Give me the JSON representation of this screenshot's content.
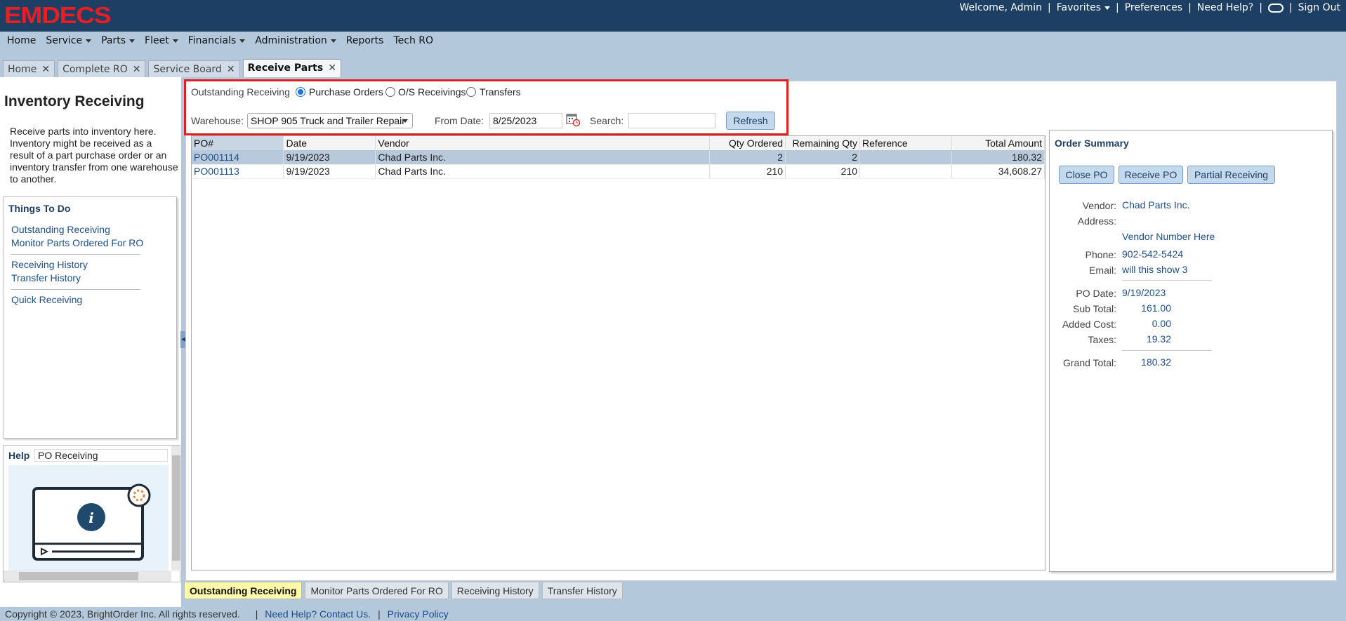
{
  "app": {
    "logo": "EMDECS"
  },
  "top": {
    "welcome": "Welcome, Admin",
    "favorites": "Favorites",
    "preferences": "Preferences",
    "help": "Need Help?",
    "signout": "Sign Out",
    "pipe": "|"
  },
  "menu": [
    {
      "label": "Home"
    },
    {
      "label": "Service"
    },
    {
      "label": "Parts"
    },
    {
      "label": "Fleet"
    },
    {
      "label": "Financials"
    },
    {
      "label": "Administration"
    },
    {
      "label": "Reports"
    },
    {
      "label": "Tech RO"
    }
  ],
  "tabs": [
    {
      "label": "Home"
    },
    {
      "label": "Complete RO"
    },
    {
      "label": "Service Board"
    },
    {
      "label": "Receive Parts"
    }
  ],
  "close_glyph": "✕",
  "left": {
    "title": "Inventory Receiving",
    "description": "Receive parts into inventory here. Inventory might be received as a result of a part purchase order or an inventory transfer from one warehouse to another.",
    "todo_title": "Things To Do",
    "links": [
      "Outstanding Receiving",
      "Monitor Parts Ordered For RO",
      "Receiving History",
      "Transfer History",
      "Quick Receiving"
    ],
    "help_label": "Help",
    "help_value": "PO Receiving",
    "help_icon": "i"
  },
  "filter": {
    "label": "Outstanding Receiving",
    "options": [
      "Purchase Orders",
      "O/S Receivings",
      "Transfers"
    ],
    "selected": "Purchase Orders",
    "warehouse_label": "Warehouse:",
    "warehouse_value": "SHOP 905 Truck and Trailer Repair",
    "from_date_label": "From Date:",
    "from_date": "8/25/2023",
    "search_label": "Search:",
    "search_value": "",
    "refresh": "Refresh"
  },
  "grid": {
    "columns": [
      "PO#",
      "Date",
      "Vendor",
      "Qty Ordered",
      "Remaining Qty",
      "Reference",
      "Total Amount"
    ],
    "rows": [
      [
        "PO001114",
        "9/19/2023",
        "Chad Parts Inc.",
        "2",
        "2",
        "",
        "180.32"
      ],
      [
        "PO001113",
        "9/19/2023",
        "Chad Parts Inc.",
        "210",
        "210",
        "",
        "34,608.27"
      ]
    ]
  },
  "summary": {
    "title": "Order Summary",
    "buttons": [
      "Close PO",
      "Receive PO",
      "Partial Receiving"
    ],
    "vendor_label": "Vendor:",
    "vendor": "Chad Parts Inc.",
    "address_label": "Address:",
    "vendor_number": "Vendor Number Here",
    "phone_label": "Phone:",
    "phone": "902-542-5424",
    "email_label": "Email:",
    "email": "will this show 3",
    "po_date_label": "PO Date:",
    "po_date": "9/19/2023",
    "subtotal_label": "Sub Total:",
    "subtotal": "161.00",
    "added_label": "Added Cost:",
    "added": "0.00",
    "taxes_label": "Taxes:",
    "taxes": "19.32",
    "grand_label": "Grand Total:",
    "grand": "180.32"
  },
  "bottom_tabs": [
    "Outstanding Receiving",
    "Monitor Parts Ordered For RO",
    "Receiving History",
    "Transfer History"
  ],
  "footer": {
    "copyright": "Copyright © 2023, BrightOrder Inc. All rights reserved.",
    "contact": "Need Help? Contact Us.",
    "privacy": "Privacy Policy",
    "pipe": "|"
  }
}
